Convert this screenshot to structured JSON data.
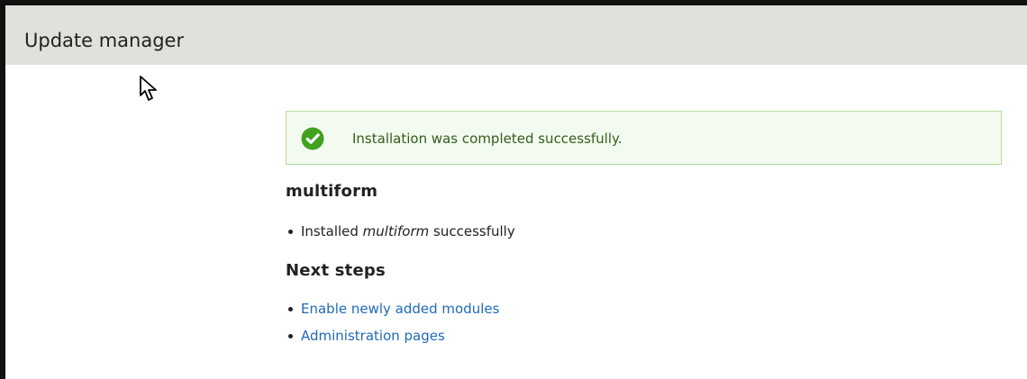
{
  "header": {
    "title": "Update manager"
  },
  "message": {
    "status_icon": "check-circle-icon",
    "text": "Installation was completed successfully."
  },
  "module_section": {
    "title": "multiform",
    "items": [
      {
        "prefix": "Installed ",
        "module": "multiform",
        "suffix": " successfully"
      }
    ]
  },
  "next_steps": {
    "title": "Next steps",
    "links": [
      {
        "label": "Enable newly added modules"
      },
      {
        "label": "Administration pages"
      }
    ]
  },
  "colors": {
    "header_background": "#e1e0db",
    "message_background": "#f3faef",
    "message_border": "#b8da9d",
    "success_icon": "#43a120",
    "link": "#1f6ab7"
  }
}
